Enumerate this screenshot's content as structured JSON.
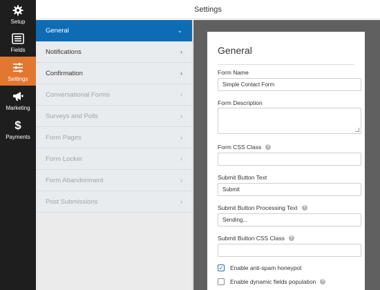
{
  "rail": {
    "items": [
      {
        "label": "Setup",
        "icon": "gear-icon"
      },
      {
        "label": "Fields",
        "icon": "fields-icon"
      },
      {
        "label": "Settings",
        "icon": "sliders-icon",
        "active": true
      },
      {
        "label": "Marketing",
        "icon": "megaphone-icon"
      },
      {
        "label": "Payments",
        "icon": "dollar-icon"
      }
    ],
    "active_color": "#e27730"
  },
  "topbar": {
    "title": "Settings"
  },
  "menu": {
    "items": [
      {
        "label": "General",
        "state": "active"
      },
      {
        "label": "Notifications",
        "state": "normal"
      },
      {
        "label": "Confirmation",
        "state": "normal"
      },
      {
        "label": "Conversational Forms",
        "state": "disabled"
      },
      {
        "label": "Surveys and Polls",
        "state": "disabled"
      },
      {
        "label": "Form Pages",
        "state": "disabled"
      },
      {
        "label": "Form Locker",
        "state": "disabled"
      },
      {
        "label": "Form Abandonment",
        "state": "disabled"
      },
      {
        "label": "Post Submissions",
        "state": "disabled"
      }
    ],
    "active_color": "#0e6cb5"
  },
  "panel": {
    "title": "General",
    "form_name": {
      "label": "Form Name",
      "value": "Simple Contact Form"
    },
    "form_description": {
      "label": "Form Description",
      "value": ""
    },
    "form_css_class": {
      "label": "Form CSS Class",
      "value": ""
    },
    "submit_text": {
      "label": "Submit Button Text",
      "value": "Submit"
    },
    "submit_processing": {
      "label": "Submit Button Processing Text",
      "value": "Sending..."
    },
    "submit_css_class": {
      "label": "Submit Button CSS Class",
      "value": ""
    },
    "honeypot": {
      "label": "Enable anti-spam honeypot",
      "checked": true
    },
    "dynamic_fields": {
      "label": "Enable dynamic fields population",
      "checked": false
    }
  }
}
